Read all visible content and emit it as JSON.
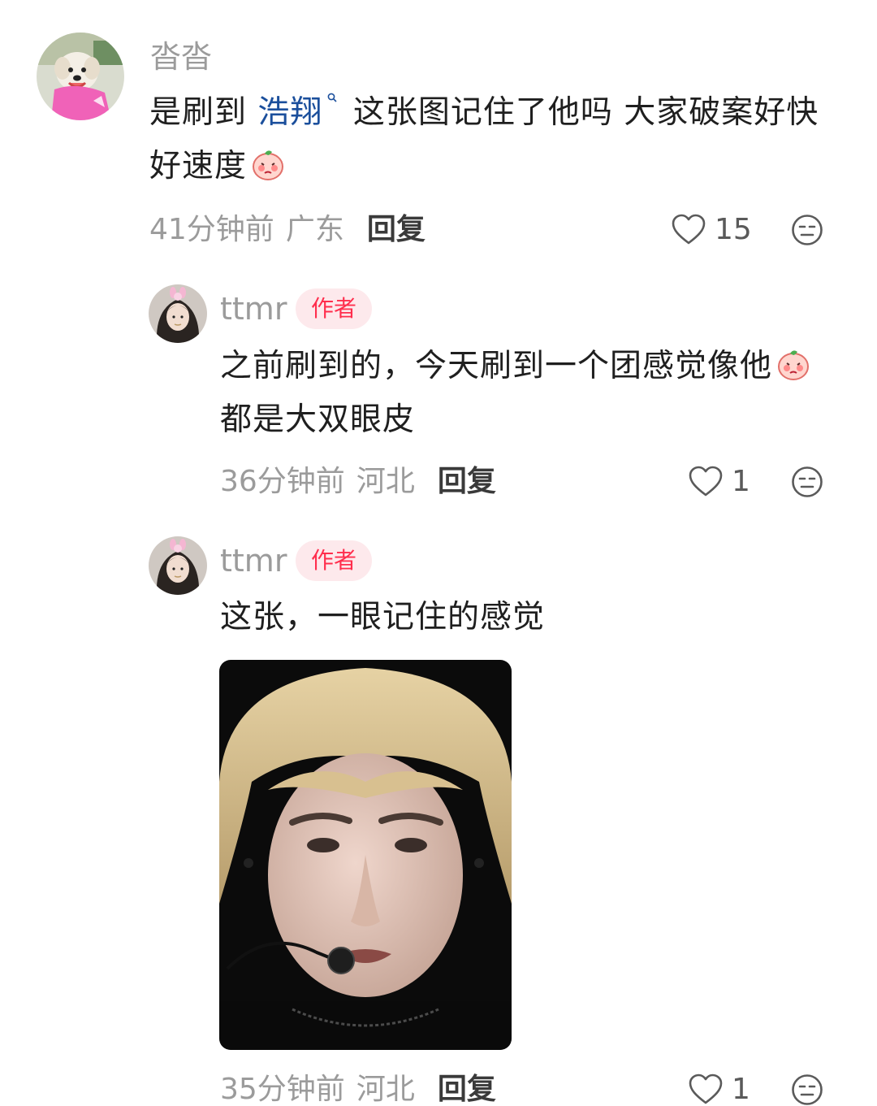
{
  "comments": [
    {
      "username": "沓沓",
      "text_before_mention": "是刷到 ",
      "mention": "浩翔",
      "text_after_mention": " 这张图记住了他吗 大家破案好快",
      "text_line2": "好速度",
      "emoji": "peach-shy-emoji",
      "time": "41分钟前",
      "location": "广东",
      "reply_label": "回复",
      "likes": "15"
    },
    {
      "username": "ttmr",
      "badge": "作者",
      "text_line1": "之前刷到的，今天刷到一个团感觉像他",
      "text_line2": "都是大双眼皮",
      "emoji": "peach-shy-emoji",
      "time": "36分钟前",
      "location": "河北",
      "reply_label": "回复",
      "likes": "1"
    },
    {
      "username": "ttmr",
      "badge": "作者",
      "text_line1": "这张，一眼记住的感觉",
      "time": "35分钟前",
      "location": "河北",
      "reply_label": "回复",
      "likes": "1"
    }
  ],
  "icons": {
    "like": "heart-outline-icon",
    "dislike": "neutral-face-icon",
    "mention": "search-icon"
  },
  "colors": {
    "badge_text": "#ff2e4d",
    "badge_bg": "#fde9ec",
    "mention": "#1b4f9c",
    "meta": "#9b9b9b"
  }
}
